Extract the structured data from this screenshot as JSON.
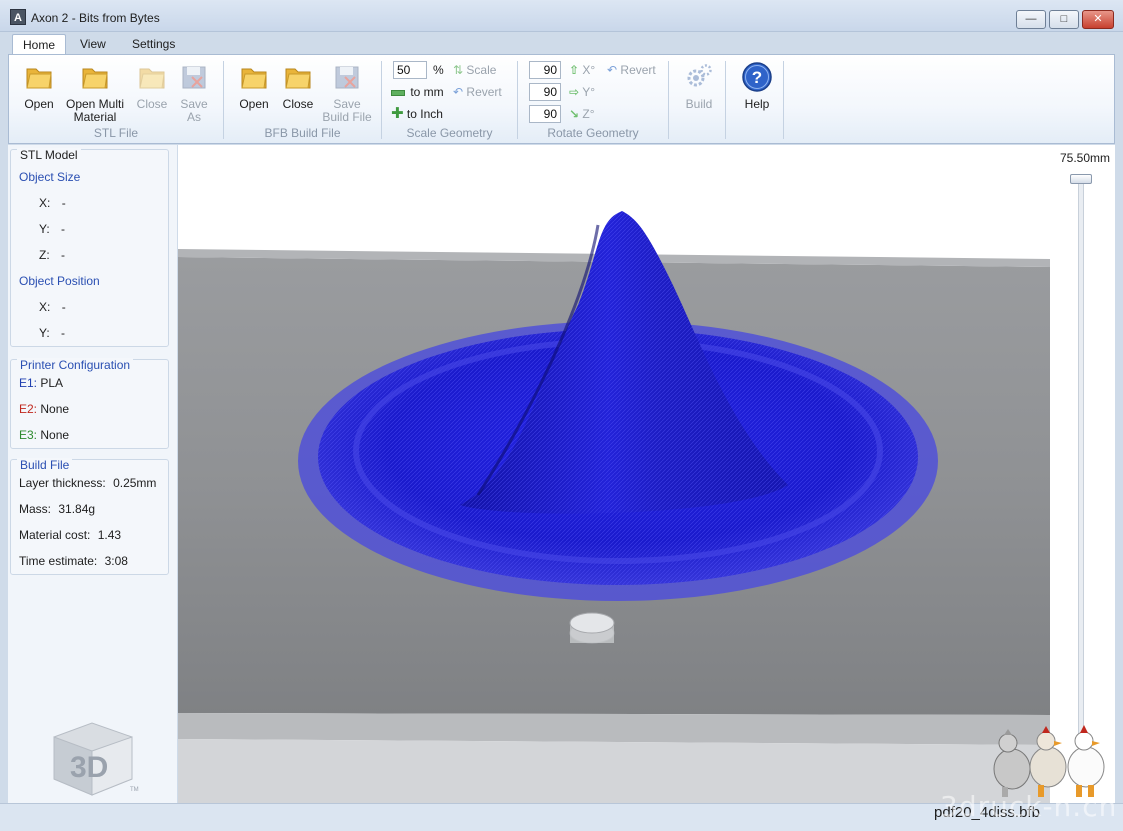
{
  "window": {
    "title": "Axon 2 - Bits from Bytes",
    "icon": "axon-logo-icon"
  },
  "tabs": [
    {
      "label": "Home",
      "active": true
    },
    {
      "label": "View",
      "active": false
    },
    {
      "label": "Settings",
      "active": false
    }
  ],
  "ribbon": {
    "stl_file": {
      "group_label": "STL File",
      "open": "Open",
      "open_multi_line1": "Open Multi",
      "open_multi_line2": "Material",
      "close": "Close",
      "save_as_line1": "Save",
      "save_as_line2": "As"
    },
    "bfb_build_file": {
      "group_label": "BFB Build File",
      "open": "Open",
      "close": "Close",
      "save_line1": "Save",
      "save_line2": "Build File"
    },
    "scale_geometry": {
      "group_label": "Scale Geometry",
      "percent_value": "50",
      "percent_symbol": "%",
      "scale": "Scale",
      "to_mm": "to mm",
      "revert": "Revert",
      "to_inch": "to Inch"
    },
    "rotate_geometry": {
      "group_label": "Rotate Geometry",
      "x_value": "90",
      "y_value": "90",
      "z_value": "90",
      "x_label": "X°",
      "y_label": "Y°",
      "z_label": "Z°",
      "revert": "Revert"
    },
    "build": "Build",
    "help": "Help"
  },
  "stl_model": {
    "title": "STL Model",
    "object_size_label": "Object Size",
    "size_x_label": "X:",
    "size_x_value": "-",
    "size_y_label": "Y:",
    "size_y_value": "-",
    "size_z_label": "Z:",
    "size_z_value": "-",
    "object_position_label": "Object Position",
    "pos_x_label": "X:",
    "pos_x_value": "-",
    "pos_y_label": "Y:",
    "pos_y_value": "-"
  },
  "printer_config": {
    "title": "Printer Configuration",
    "e1_label": "E1:",
    "e1_value": "PLA",
    "e2_label": "E2:",
    "e2_value": "None",
    "e3_label": "E3:",
    "e3_value": "None",
    "colors": {
      "e1": "#1f3fb0",
      "e2": "#c0281e",
      "e3": "#2e8b2e"
    }
  },
  "build_file": {
    "title": "Build File",
    "layer_label": "Layer thickness:",
    "layer_value": "0.25mm",
    "mass_label": "Mass:",
    "mass_value": "31.84g",
    "cost_label": "Material cost:",
    "cost_value": "1.43",
    "time_label": "Time estimate:",
    "time_value": "3:08"
  },
  "viewport": {
    "height_label": "75.50mm",
    "height_level": 1.0,
    "filename": "pdf20_4diss.bfb",
    "watermark": "3druck-n.ch",
    "model_color": "#1a1ad8"
  },
  "logo": {
    "text": "3D",
    "tm": "TM"
  }
}
